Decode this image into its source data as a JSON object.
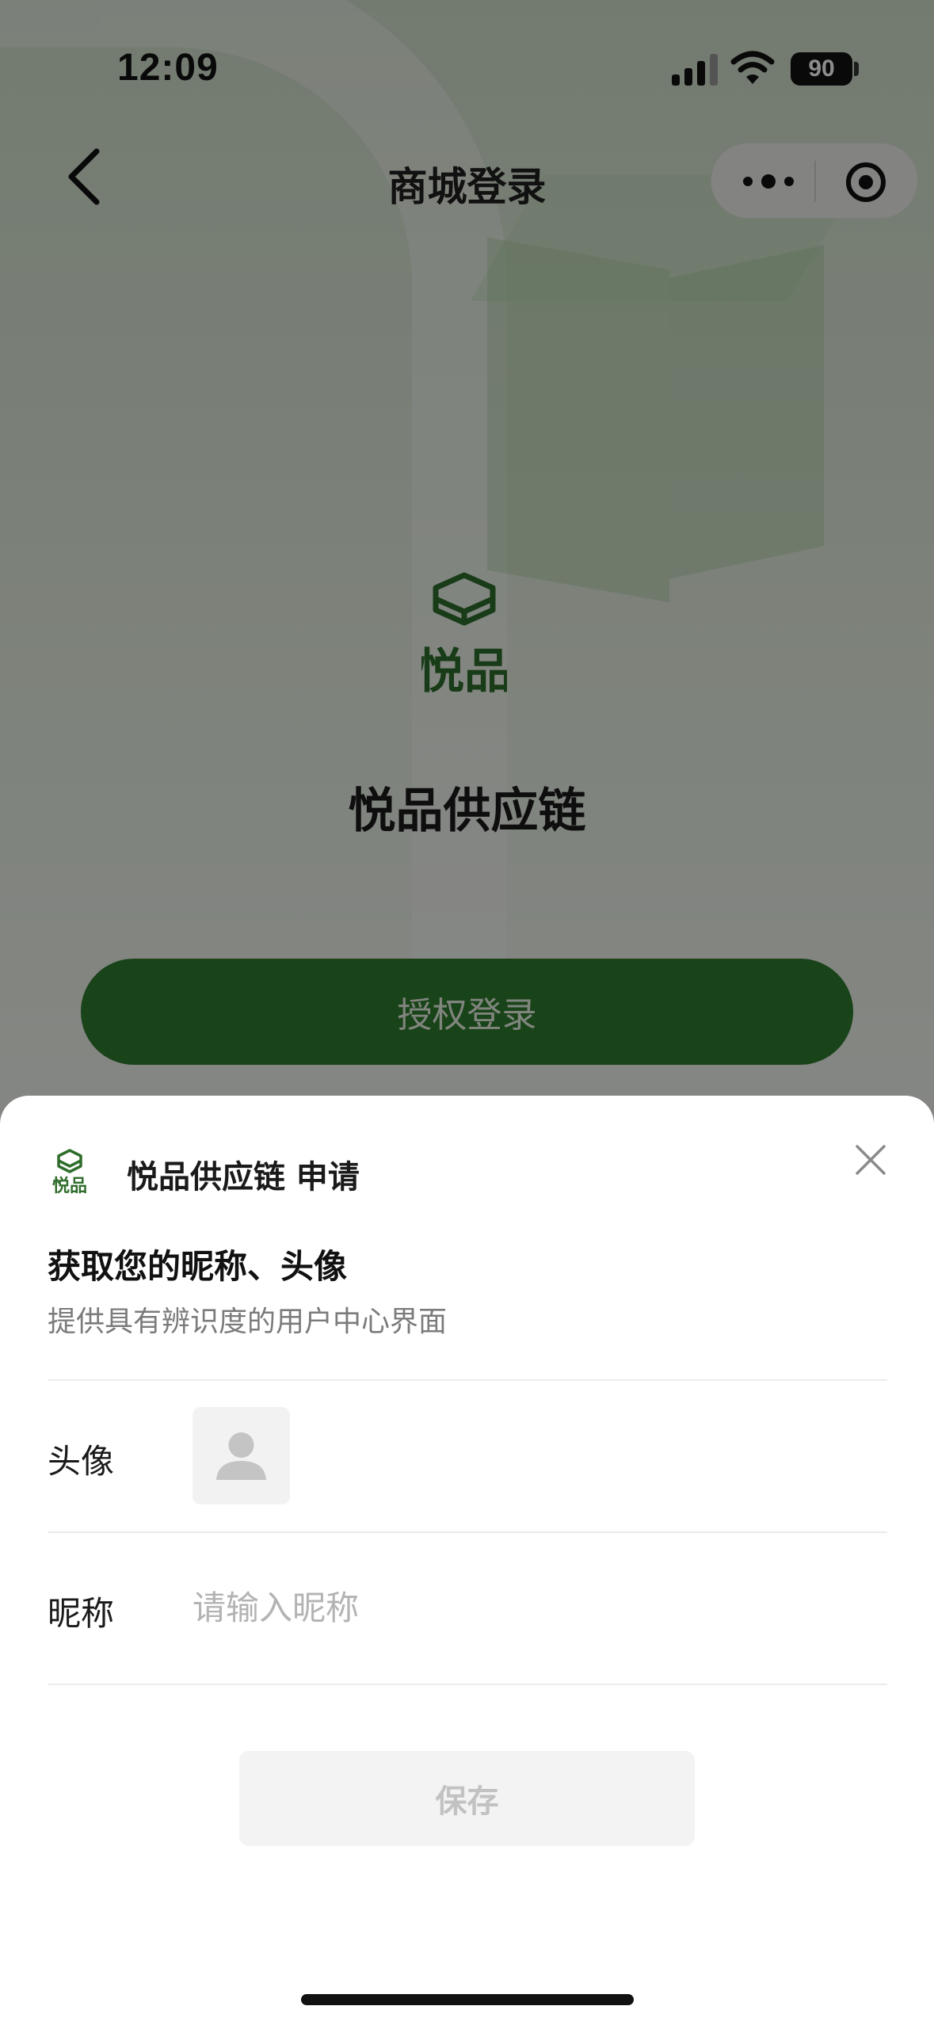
{
  "status_bar": {
    "time": "12:09",
    "battery": "90"
  },
  "nav": {
    "title": "商城登录"
  },
  "brand": {
    "name": "悦品供应链",
    "logo_text": "悦品",
    "logo_color": "#2f6d2c"
  },
  "login": {
    "button_label": "授权登录",
    "accent": "#2f7b2c"
  },
  "sheet": {
    "app_title": "悦品供应链 申请",
    "heading": "获取您的昵称、头像",
    "description": "提供具有辨识度的用户中心界面",
    "avatar_label": "头像",
    "nickname_label": "昵称",
    "nickname_placeholder": "请输入昵称",
    "nickname_value": "",
    "save_label": "保存"
  },
  "icons": {
    "back": "chevron-left-icon",
    "more": "more-dots-icon",
    "target": "target-icon",
    "close": "close-icon",
    "avatar_placeholder": "person-icon",
    "signal": "signal-icon",
    "wifi": "wifi-icon"
  }
}
